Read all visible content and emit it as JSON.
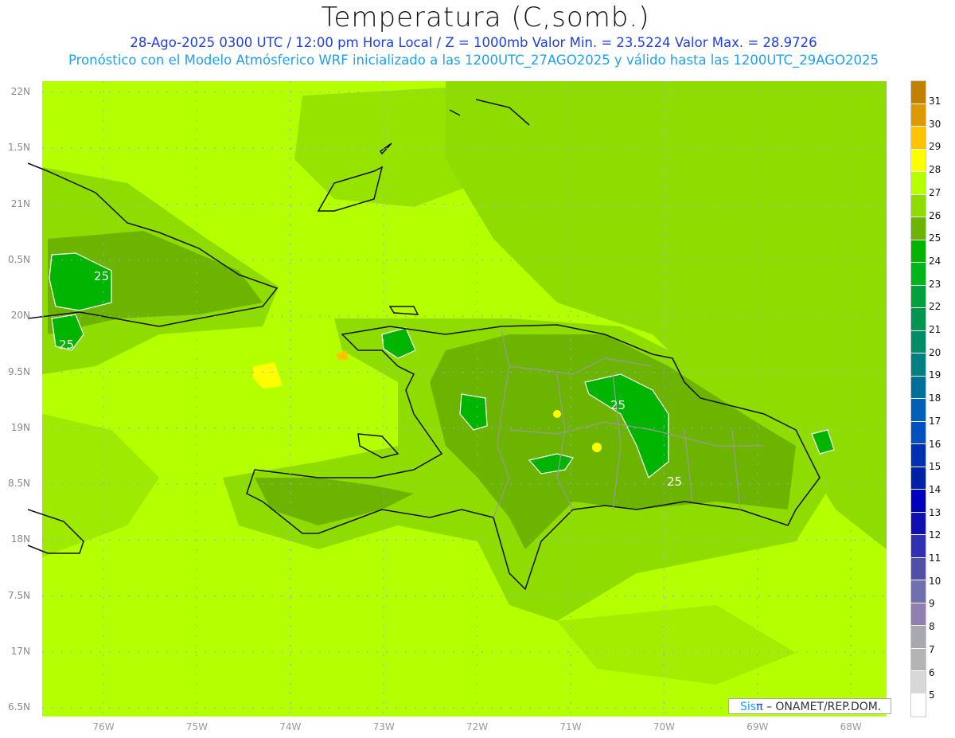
{
  "header": {
    "title": "Temperatura (C,somb.)",
    "subtitle1": "28-Ago-2025 0300 UTC / 12:00 pm Hora Local / Z = 1000mb   Valor Min. = 23.5224   Valor Max. = 28.9726",
    "subtitle2": "Pronóstico con el Modelo Atmósferico WRF inicializado a las 1200UTC_27AGO2025 y válido hasta las  1200UTC_29AGO2025"
  },
  "axes": {
    "lat_labels": [
      "22N",
      "1.5N",
      "21N",
      "0.5N",
      "20N",
      "9.5N",
      "19N",
      "8.5N",
      "18N",
      "7.5N",
      "17N",
      "6.5N"
    ],
    "lon_labels": [
      "76W",
      "75W",
      "74W",
      "73W",
      "72W",
      "71W",
      "70W",
      "69W",
      "68W"
    ]
  },
  "contour_labels": [
    "25",
    "25",
    "25",
    "25"
  ],
  "colorbar": {
    "colors": [
      "#c08000",
      "#e09800",
      "#ffc400",
      "#ffff00",
      "#b4ff00",
      "#8fdc00",
      "#6cb400",
      "#00b400",
      "#00b41c",
      "#00a03c",
      "#009650",
      "#008c64",
      "#008080",
      "#007098",
      "#0060b8",
      "#0050c0",
      "#0030b0",
      "#0020a8",
      "#0000c0",
      "#1010b0",
      "#3030b0",
      "#5050a8",
      "#7070b0",
      "#9080b0",
      "#a8a8b0",
      "#b4b4b4",
      "#d8d8d8",
      "#ffffff"
    ],
    "labels": [
      "31",
      "30",
      "29",
      "28",
      "27",
      "26",
      "25",
      "24",
      "23",
      "22",
      "21",
      "20",
      "19",
      "18",
      "17",
      "16",
      "15",
      "14",
      "13",
      "12",
      "11",
      "10",
      "9",
      "8",
      "7",
      "6",
      "5"
    ]
  },
  "credit": {
    "sis": "Sis",
    "pi": "π",
    "rest": " –  ONAMET/REP.DOM."
  }
}
